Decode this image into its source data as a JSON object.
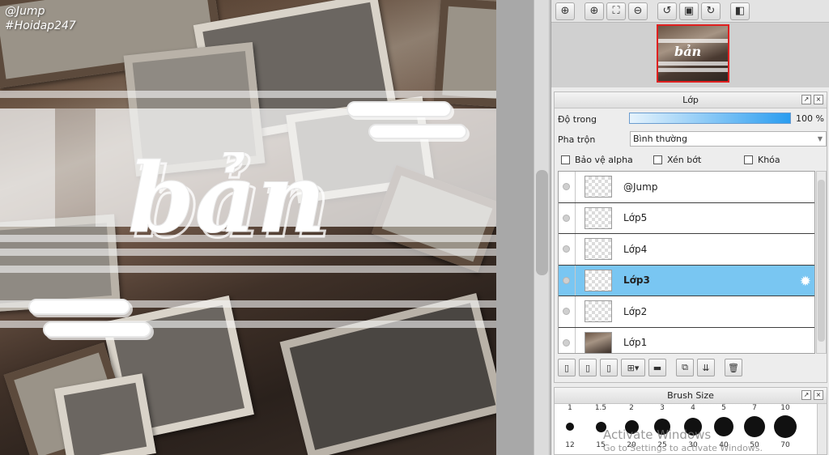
{
  "canvas": {
    "watermark_line1": "@Jump",
    "watermark_line2": "#Hoidap247",
    "artwork_text": "bản"
  },
  "toolbar": {
    "icons": [
      "zoom-fit-icon",
      "zoom-in-icon",
      "fit-screen-icon",
      "zoom-out-icon",
      "rotate-left-icon",
      "reset-view-icon",
      "rotate-right-icon",
      "flip-icon"
    ]
  },
  "layer_panel": {
    "title": "Lớp",
    "opacity_label": "Độ trong",
    "opacity_value": "100 %",
    "opacity_level": 1.0,
    "blend_label": "Pha trộn",
    "blend_value": "Bình thường",
    "checkboxes": [
      {
        "label": "Bảo vệ alpha",
        "checked": false
      },
      {
        "label": "Xén bớt",
        "checked": false
      },
      {
        "label": "Khóa",
        "checked": false
      }
    ],
    "layers": [
      {
        "name": "@Jump",
        "selected": false,
        "thumb": "transparent"
      },
      {
        "name": "Lớp5",
        "selected": false,
        "thumb": "transparent"
      },
      {
        "name": "Lớp4",
        "selected": false,
        "thumb": "transparent"
      },
      {
        "name": "Lớp3",
        "selected": true,
        "thumb": "transparent"
      },
      {
        "name": "Lớp2",
        "selected": false,
        "thumb": "transparent"
      },
      {
        "name": "Lớp1",
        "selected": false,
        "thumb": "photo"
      }
    ],
    "accent_color": "#79c6f2"
  },
  "brush_panel": {
    "title": "Brush Size",
    "top_sizes": [
      "1",
      "1.5",
      "2",
      "3",
      "4",
      "5",
      "7",
      "10"
    ],
    "bottom_sizes": [
      "12",
      "15",
      "20",
      "25",
      "30",
      "40",
      "50",
      "70"
    ]
  },
  "os_overlay": {
    "line1": "Activate Windows",
    "line2": "Go to Settings to activate Windows."
  }
}
